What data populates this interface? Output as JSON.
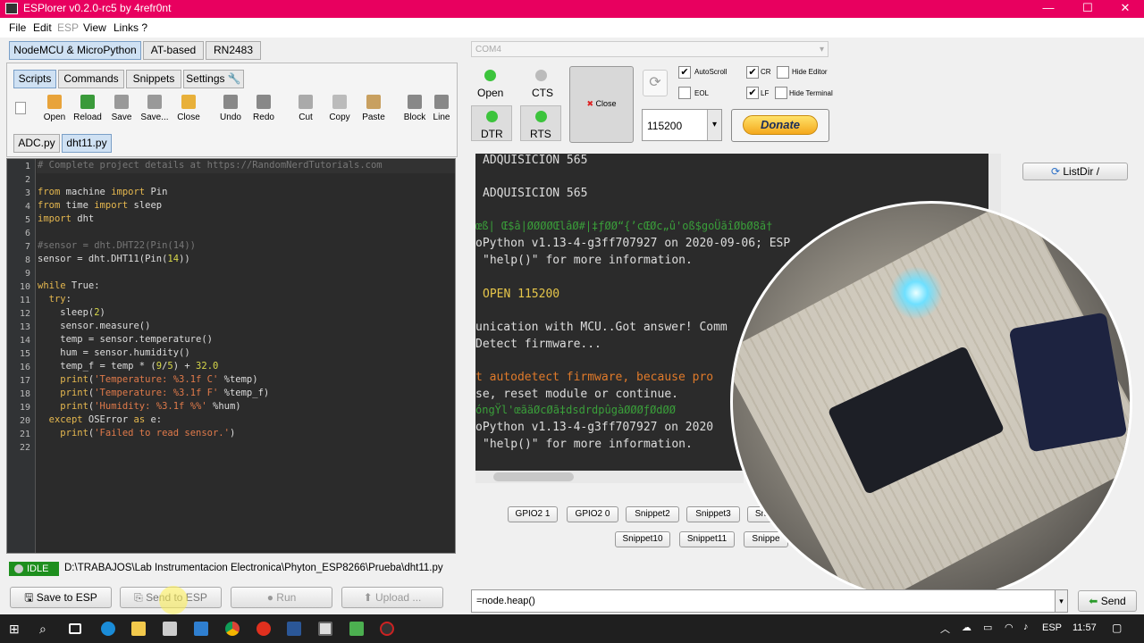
{
  "window": {
    "title": "ESPlorer v0.2.0-rc5 by 4refr0nt",
    "min": "—",
    "max": "☐",
    "close": "✕"
  },
  "menu": [
    "File",
    "Edit",
    "ESP",
    "View",
    "Links ?"
  ],
  "left_tabs": [
    "NodeMCU & MicroPython",
    "AT-based",
    "RN2483"
  ],
  "sub_tabs": [
    "Scripts",
    "Commands",
    "Snippets",
    "Settings"
  ],
  "toolbar": [
    {
      "label": "Open",
      "color": "#e8a33a"
    },
    {
      "label": "Reload",
      "color": "#3a9a3a"
    },
    {
      "label": "Save",
      "color": "#999999"
    },
    {
      "label": "Save...",
      "color": "#999999"
    },
    {
      "label": "Close",
      "color": "#e8b03a"
    },
    {
      "label": "Undo",
      "color": "#888888"
    },
    {
      "label": "Redo",
      "color": "#888888"
    },
    {
      "label": "Cut",
      "color": "#aaaaaa"
    },
    {
      "label": "Copy",
      "color": "#bbbbbb"
    },
    {
      "label": "Paste",
      "color": "#c8a060"
    },
    {
      "label": "Block",
      "color": "#888888"
    },
    {
      "label": "Line",
      "color": "#888888"
    }
  ],
  "file_tabs": [
    "ADC.py",
    "dht11.py"
  ],
  "code_lines": [
    "# Complete project details at https://RandomNerdTutorials.com",
    "",
    "from machine import Pin",
    "from time import sleep",
    "import dht",
    "",
    "#sensor = dht.DHT22(Pin(14))",
    "sensor = dht.DHT11(Pin(14))",
    "",
    "while True:",
    "  try:",
    "    sleep(2)",
    "    sensor.measure()",
    "    temp = sensor.temperature()",
    "    hum = sensor.humidity()",
    "    temp_f = temp * (9/5) + 32.0",
    "    print('Temperature: %3.1f C' %temp)",
    "    print('Temperature: %3.1f F' %temp_f)",
    "    print('Humidity: %3.1f %%' %hum)",
    "  except OSError as e:",
    "    print('Failed to read sensor.')",
    ""
  ],
  "status": {
    "state": "IDLE",
    "path": "D:\\TRABAJOS\\Lab Instrumentacion Electronica\\Phyton_ESP8266\\Prueba\\dht11.py"
  },
  "bottom_buttons": {
    "save": "Save to ESP",
    "send": "Send to ESP",
    "run": "Run",
    "upload": "Upload ..."
  },
  "port": {
    "name": "COM4",
    "open": "Open",
    "cts": "CTS",
    "dtr": "DTR",
    "rts": "RTS",
    "close": "Close",
    "baud": "115200",
    "donate": "Donate"
  },
  "checks": {
    "autoscroll": "AutoScroll",
    "eol": "EOL",
    "cr": "CR",
    "lf": "LF",
    "hide_editor": "Hide Editor",
    "hide_terminal": "Hide Terminal"
  },
  "listdir": "ListDir /",
  "terminal_lines": [
    "ADQUISICION 565",
    "",
    "ADQUISICION 565",
    "",
    "œß| Œ$â|ØØØØŒlâØ#|‡ƒØØ“{’cŒØc„û'oß$goÜãîØbØ8ã†",
    "oPython v1.13-4-g3ff707927 on 2020-09-06; ESP",
    "\"help()\" for more information.",
    "",
    "OPEN 115200",
    "",
    "unication with MCU..Got answer! Comm",
    "Detect firmware...",
    "",
    "t autodetect firmware, because pro",
    "se, reset module or continue.",
    "óngŸl'œãäØcØã‡dsdrdpûgàØØØƒØdØØ",
    "oPython v1.13-4-g3ff707927 on 2020",
    "\"help()\" for more information."
  ],
  "snippets": [
    "GPIO2 1",
    "GPIO2 0",
    "Snippet2",
    "Snippet3",
    "Sn",
    "Snippet10",
    "Snippet11",
    "Snippe"
  ],
  "command": {
    "value": "=node.heap()",
    "send": "Send"
  },
  "tray": {
    "lang": "ESP",
    "time": "11:57"
  }
}
